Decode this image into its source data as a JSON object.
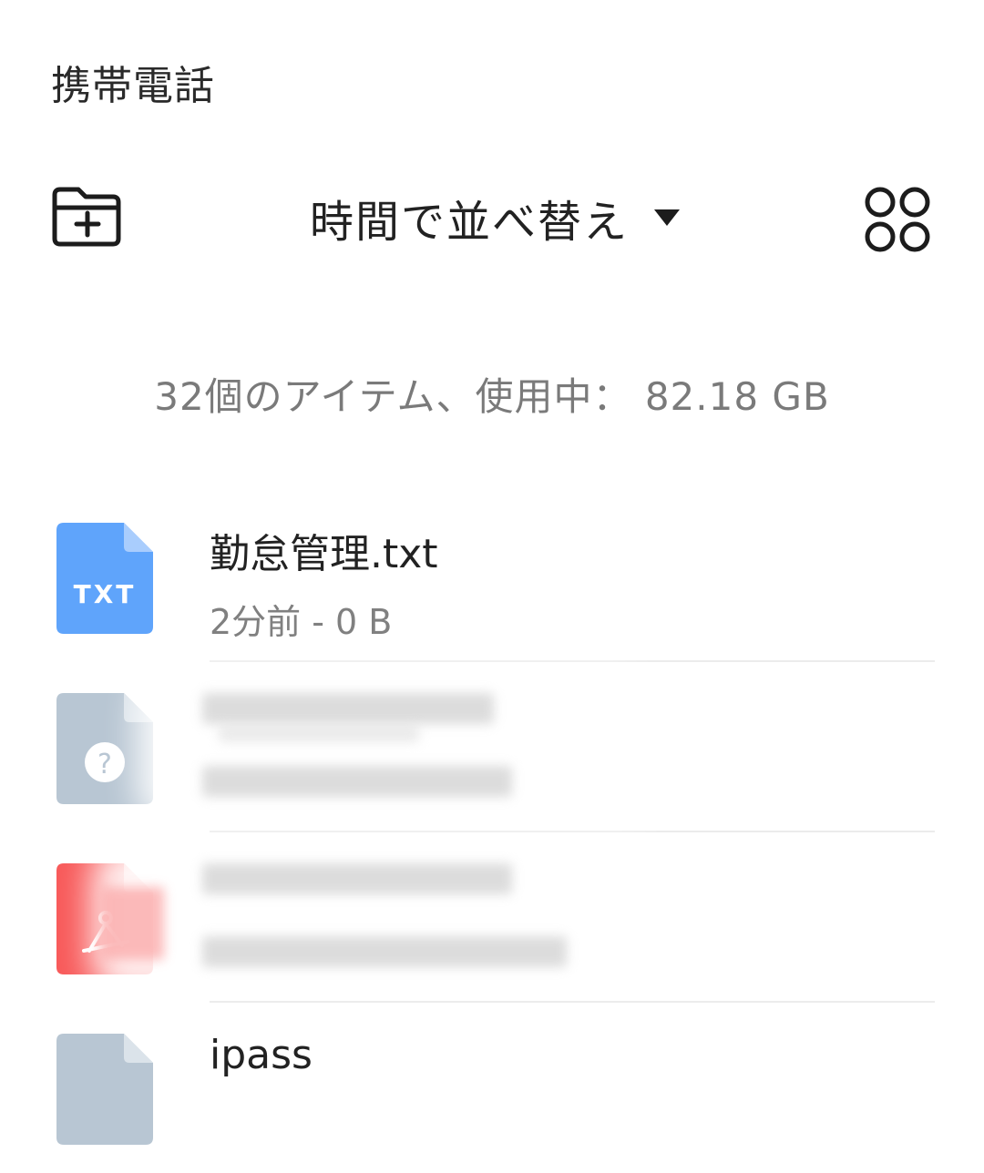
{
  "header": {
    "title": "携帯電話"
  },
  "toolbar": {
    "new_folder_icon": "folder-plus-icon",
    "sort_label": "時間で並べ替え",
    "sort_caret_icon": "caret-down-icon",
    "view_toggle_icon": "grid-view-icon"
  },
  "summary": {
    "text": "32個のアイテム、使用中： 82.18 GB"
  },
  "files": [
    {
      "name": "勤怠管理.txt",
      "meta": "2分前 - 0 B",
      "type_label": "TXT",
      "icon": "txt-file-icon",
      "color": "#5fa4fb",
      "fold_color": "#a9cdfd"
    },
    {
      "name": "",
      "meta": "",
      "type_label": "?",
      "icon": "unknown-file-icon",
      "color": "#b8c6d3",
      "fold_color": "#dbe3ea",
      "redacted": true
    },
    {
      "name": "",
      "meta": "",
      "type_label": "",
      "icon": "pdf-file-icon",
      "color": "#f85a5a",
      "fold_color": "#fbb0b0",
      "redacted": true
    },
    {
      "name": "ipass",
      "meta": "",
      "type_label": "",
      "icon": "unknown-file-icon",
      "color": "#b8c6d3",
      "fold_color": "#dbe3ea"
    }
  ]
}
